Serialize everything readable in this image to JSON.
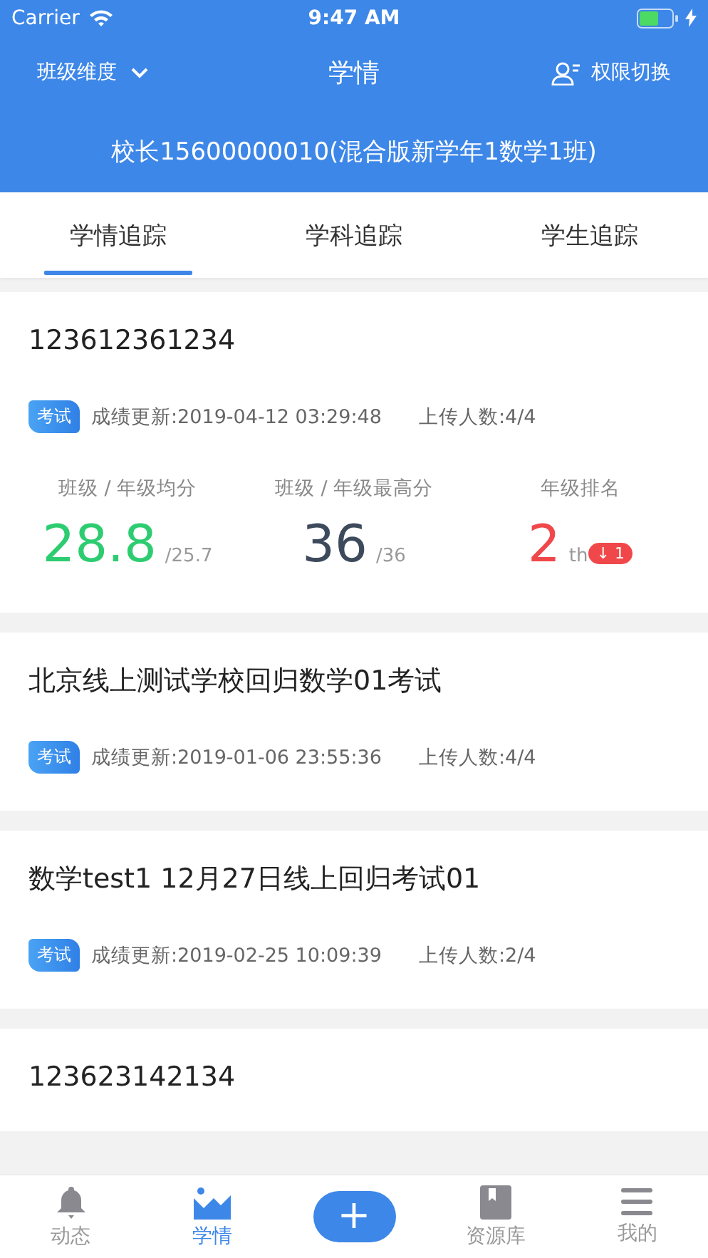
{
  "status_bar": {
    "carrier": "Carrier",
    "time": "9:47 AM"
  },
  "header": {
    "dimension": "班级维度",
    "title": "学情",
    "switch": "权限切换",
    "subtitle": "校长15600000010(混合版新学年1数学1班)"
  },
  "tabs": [
    {
      "label": "学情追踪",
      "selected": true
    },
    {
      "label": "学科追踪",
      "selected": false
    },
    {
      "label": "学生追踪",
      "selected": false
    }
  ],
  "exams": [
    {
      "title": "123612361234",
      "tag": "考试",
      "updated": "成绩更新:2019-04-12 03:29:48",
      "uploaded": "上传人数:4/4",
      "stats": [
        {
          "kind": "score",
          "label": "班级 / 年级均分",
          "value": "28.8",
          "sub": "/25.7",
          "color": "#2ecc71"
        },
        {
          "kind": "score",
          "label": "班级 / 年级最高分",
          "value": "36",
          "sub": "/36",
          "color": "#3d4a5c"
        },
        {
          "kind": "rank",
          "label": "年级排名",
          "value": "2",
          "sub": "th",
          "change": "↓ 1",
          "color": "#f0484a"
        }
      ]
    },
    {
      "title": "北京线上测试学校回归数学01考试",
      "tag": "考试",
      "updated": "成绩更新:2019-01-06 23:55:36",
      "uploaded": "上传人数:4/4"
    },
    {
      "title": "数学test1 12月27日线上回归考试01",
      "tag": "考试",
      "updated": "成绩更新:2019-02-25 10:09:39",
      "uploaded": "上传人数:2/4"
    },
    {
      "title": "123623142134"
    }
  ],
  "tab_bar": [
    {
      "kind": "bell",
      "label": "动态",
      "selected": false
    },
    {
      "kind": "chart",
      "label": "学情",
      "selected": true
    },
    {
      "kind": "add",
      "label": "+"
    },
    {
      "kind": "book",
      "label": "资源库",
      "selected": false
    },
    {
      "kind": "menu",
      "label": "我的",
      "selected": false
    }
  ]
}
